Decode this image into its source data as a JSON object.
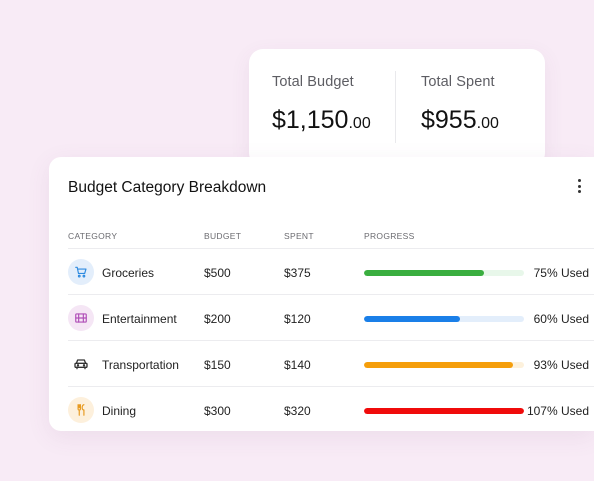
{
  "totals": {
    "budget": {
      "label": "Total Budget",
      "dollars": "$1,150",
      "cents": ".00"
    },
    "spent": {
      "label": "Total Spent",
      "dollars": "$955",
      "cents": ".00"
    }
  },
  "breakdown": {
    "title": "Budget Category Breakdown",
    "more_icon": "more-vertical-icon",
    "columns": {
      "category": "CATEGORY",
      "budget": "BUDGET",
      "spent": "SPENT",
      "progress": "PROGRESS"
    },
    "rows": [
      {
        "name": "Groceries",
        "icon": "cart-icon",
        "budget": "$500",
        "spent": "$375",
        "used_label": "75% Used",
        "progress": 0.75,
        "color": "#3aae3f",
        "track_color": "#e8f7ea",
        "icon_bg": "#e3eefb",
        "icon_color": "#2f8be0"
      },
      {
        "name": "Entertainment",
        "icon": "film-icon",
        "budget": "$200",
        "spent": "$120",
        "used_label": "60% Used",
        "progress": 0.6,
        "color": "#1a7fe8",
        "track_color": "#e3eefb",
        "icon_bg": "#f5e6f5",
        "icon_color": "#b04fb8"
      },
      {
        "name": "Transportation",
        "icon": "car-icon",
        "budget": "$150",
        "spent": "$140",
        "used_label": "93% Used",
        "progress": 0.93,
        "color": "#f59e0b",
        "track_color": "#fdf1dc",
        "icon_bg": "#ffffff",
        "icon_color": "#333333"
      },
      {
        "name": "Dining",
        "icon": "utensils-icon",
        "budget": "$300",
        "spent": "$320",
        "used_label": "107% Used",
        "progress": 1.0,
        "color": "#f00b0b",
        "track_color": "#fde2e2",
        "icon_bg": "#fdf0dc",
        "icon_color": "#e89a1f"
      }
    ]
  }
}
